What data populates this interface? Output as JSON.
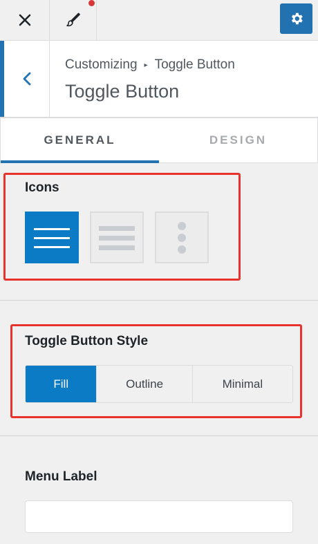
{
  "toolbar": {
    "close_icon": "close-icon",
    "brush_icon": "brush-icon",
    "settings_icon": "gear-icon",
    "accent": "#2271b1",
    "notification_color": "#d63638"
  },
  "header": {
    "breadcrumb_root": "Customizing",
    "breadcrumb_separator": "▸",
    "breadcrumb_current": "Toggle Button",
    "title": "Toggle Button"
  },
  "tabs": [
    {
      "label": "GENERAL",
      "active": true
    },
    {
      "label": "DESIGN",
      "active": false
    }
  ],
  "icons_section": {
    "label": "Icons",
    "options": [
      {
        "name": "hamburger-three-lines",
        "selected": true
      },
      {
        "name": "hamburger-thick-lines",
        "selected": false
      },
      {
        "name": "vertical-dots",
        "selected": false
      }
    ]
  },
  "style_section": {
    "label": "Toggle Button Style",
    "options": [
      {
        "label": "Fill",
        "selected": true
      },
      {
        "label": "Outline",
        "selected": false
      },
      {
        "label": "Minimal",
        "selected": false
      }
    ]
  },
  "menu_label_section": {
    "label": "Menu Label",
    "value": "",
    "placeholder": ""
  },
  "highlight_color": "#e8322d"
}
